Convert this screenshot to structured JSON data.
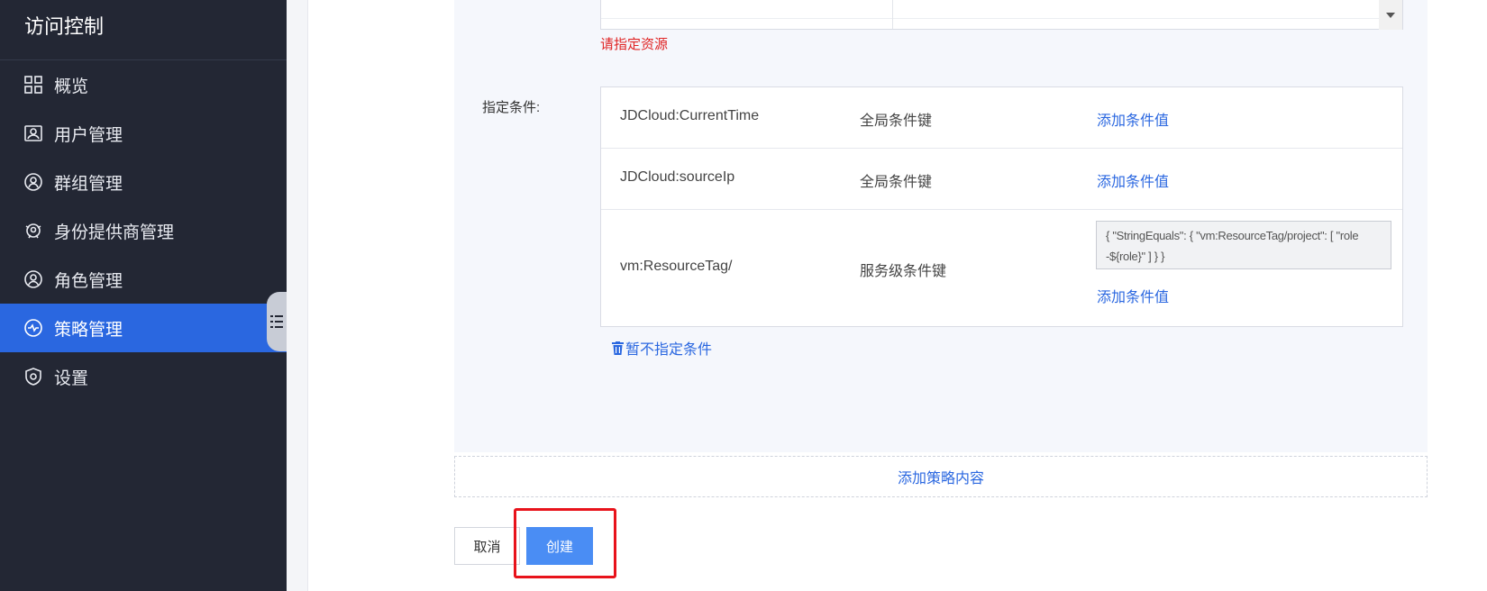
{
  "sidebar": {
    "title": "访问控制",
    "items": [
      {
        "label": "概览",
        "icon": "grid-icon",
        "active": false
      },
      {
        "label": "用户管理",
        "icon": "user-card-icon",
        "active": false
      },
      {
        "label": "群组管理",
        "icon": "group-icon",
        "active": false
      },
      {
        "label": "身份提供商管理",
        "icon": "identity-provider-icon",
        "active": false
      },
      {
        "label": "角色管理",
        "icon": "role-icon",
        "active": false
      },
      {
        "label": "策略管理",
        "icon": "policy-icon",
        "active": true
      },
      {
        "label": "设置",
        "icon": "settings-shield-icon",
        "active": false
      }
    ]
  },
  "resource": {
    "error": "请指定资源"
  },
  "condition": {
    "label": "指定条件:",
    "rows": [
      {
        "key": "JDCloud:CurrentTime",
        "type": "全局条件键",
        "link": "添加条件值"
      },
      {
        "key": "JDCloud:sourceIp",
        "type": "全局条件键",
        "link": "添加条件值"
      },
      {
        "key": "vm:ResourceTag/",
        "type": "服务级条件键",
        "value_line1": "{ \"StringEquals\": { \"vm:ResourceTag/project\": [ \"role",
        "value_line2": "-${role}\" ] } }",
        "link": "添加条件值"
      }
    ],
    "remove": "暂不指定条件"
  },
  "add_policy": "添加策略内容",
  "buttons": {
    "cancel": "取消",
    "create": "创建"
  },
  "colors": {
    "sidebar_bg": "#232734",
    "active": "#2a67e0",
    "link": "#2a67e0",
    "error": "#e02424",
    "primary_button": "#4a8df4",
    "highlight": "#e8131b"
  }
}
